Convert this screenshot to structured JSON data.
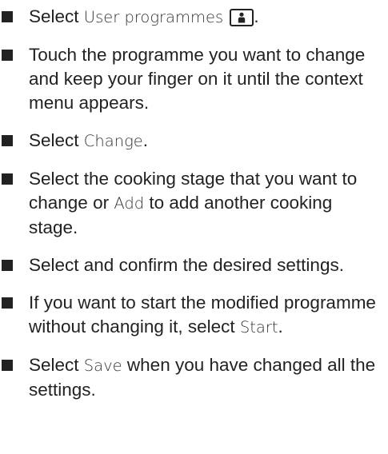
{
  "steps": [
    {
      "parts": [
        "Select ",
        "User programmes",
        "",
        "."
      ]
    },
    {
      "text": "Touch the programme you want to change and keep your finger on it until the context menu appears."
    },
    {
      "parts": [
        "Select ",
        "Change",
        "."
      ]
    },
    {
      "parts": [
        "Select the cooking stage that you want to change or ",
        "Add",
        " to add another cooking stage."
      ]
    },
    {
      "text": "Select and confirm the desired settings."
    },
    {
      "parts": [
        "If you want to start the modified programme without changing it, select ",
        "Start",
        "."
      ]
    },
    {
      "parts": [
        "Select ",
        "Save",
        " when you have changed all the settings."
      ]
    }
  ],
  "icons": {
    "user_programmes": "user-icon"
  }
}
